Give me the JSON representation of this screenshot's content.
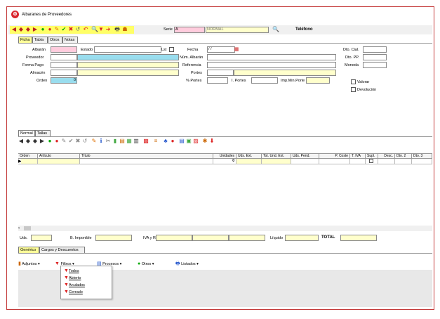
{
  "window": {
    "title": "Albaranes de Proveedores"
  },
  "toolbar1": {
    "serie_label": "Serie",
    "serie_value": "A",
    "serie_name": "NORMAL",
    "telefono_label": "Teléfono"
  },
  "tabs_top": [
    "Ficha",
    "Tabla",
    "Otros",
    "Notas"
  ],
  "form": {
    "albaran_label": "Albarán",
    "estado_label": "Estado",
    "lst_label": "Lst",
    "fecha_label": "Fecha",
    "fecha_value": "/ /",
    "dto_cial_label": "Dto. Cial.",
    "proveedor_label": "Proveedor",
    "num_albaran_label": "Núm. Albarán",
    "dto_pp_label": "Dto. PP.",
    "forma_pago_label": "Forma Pago",
    "referencia_label": "Referencia",
    "moneda_label": "Moneda",
    "almacen_label": "Almacén",
    "portes_label": "Portes",
    "orden_label": "Orden",
    "orden_value": "0",
    "pct_portes_label": "% Portes",
    "i_portes_label": "I. Portes",
    "imp_min_porte_label": "Imp.Min.Porte",
    "valorar_label": "Valorar",
    "devolucion_label": "Devolución"
  },
  "tabs_mid": [
    "Normal",
    "Tallas"
  ],
  "grid": {
    "headers": [
      "Orden",
      "Artículo",
      "Título",
      "Unidades",
      "Uds. Ext.",
      "Tot. Und. Ext.",
      "Uds. Pend.",
      "P. Coste",
      "T. IVA",
      "Supl.",
      "Desc.",
      "Dto. 2",
      "Dto. 3"
    ],
    "row": {
      "unidades": "0"
    }
  },
  "totals": {
    "uds_label": "Uds.",
    "b_imponible_label": "B. Imponible",
    "iva_rec_label": "IVA y Rec.",
    "liquido_label": "Líquido",
    "total_label": "TOTAL"
  },
  "tabs_bottom": [
    "Genérico",
    "Cargos y Descuentos"
  ],
  "bottom_toolbar": {
    "adjuntos": "Adjuntos",
    "filtros": "Filtros",
    "procesos": "Procesos",
    "otros": "Otros",
    "listados": "Listados"
  },
  "filter_menu": [
    "Todos",
    "Abierto",
    "Anulados",
    "Cerrado"
  ],
  "colors": {
    "accent": "#ffff66",
    "border": "#c43a3a",
    "title_icon": "#d9262d"
  }
}
